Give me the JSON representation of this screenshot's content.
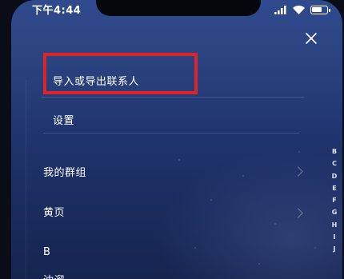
{
  "status_bar": {
    "time": "下午4:44"
  },
  "menu": {
    "items": [
      {
        "label": "导入或导出联系人"
      },
      {
        "label": "设置"
      }
    ]
  },
  "contacts": {
    "groups_label": "我的群组",
    "yellow_pages_label": "黄页",
    "section_letter": "B",
    "partial_contact": "沈溜"
  },
  "alphabet_index": [
    "B",
    "C",
    "D",
    "E",
    "F",
    "G",
    "H",
    "I",
    "J"
  ],
  "colors": {
    "highlight": "#e0232a",
    "background_top": "#2f4a8e",
    "background_bottom": "#16244f"
  }
}
